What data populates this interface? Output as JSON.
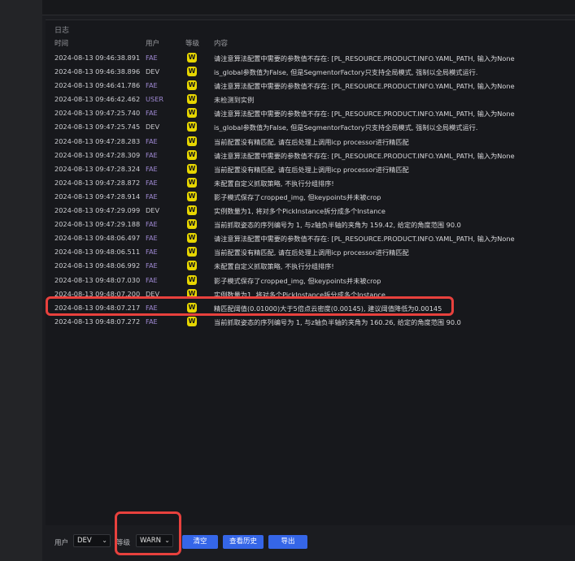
{
  "panel": {
    "title": "日志"
  },
  "columns": {
    "time": "时间",
    "user": "用户",
    "level": "等级",
    "message": "内容"
  },
  "rows": [
    {
      "time": "2024-08-13 09:46:38.891",
      "user": "FAE",
      "level": "W",
      "message": "请注意算法配置中需要的参数值不存在: [PL_RESOURCE.PRODUCT.INFO.YAML_PATH, 输入为None"
    },
    {
      "time": "2024-08-13 09:46:38.896",
      "user": "DEV",
      "level": "W",
      "message": "is_global参数值为False, 但是SegmentorFactory只支持全局模式, 强制以全局模式运行."
    },
    {
      "time": "2024-08-13 09:46:41.786",
      "user": "FAE",
      "level": "W",
      "message": "请注意算法配置中需要的参数值不存在: [PL_RESOURCE.PRODUCT.INFO.YAML_PATH, 输入为None"
    },
    {
      "time": "2024-08-13 09:46:42.462",
      "user": "USER",
      "level": "W",
      "message": "未检测到实例"
    },
    {
      "time": "2024-08-13 09:47:25.740",
      "user": "FAE",
      "level": "W",
      "message": "请注意算法配置中需要的参数值不存在: [PL_RESOURCE.PRODUCT.INFO.YAML_PATH, 输入为None"
    },
    {
      "time": "2024-08-13 09:47:25.745",
      "user": "DEV",
      "level": "W",
      "message": "is_global参数值为False, 但是SegmentorFactory只支持全局模式, 强制以全局模式运行."
    },
    {
      "time": "2024-08-13 09:47:28.283",
      "user": "FAE",
      "level": "W",
      "message": "当前配置没有精匹配, 请在后处理上调用icp processor进行精匹配"
    },
    {
      "time": "2024-08-13 09:47:28.309",
      "user": "FAE",
      "level": "W",
      "message": "请注意算法配置中需要的参数值不存在: [PL_RESOURCE.PRODUCT.INFO.YAML_PATH, 输入为None"
    },
    {
      "time": "2024-08-13 09:47:28.324",
      "user": "FAE",
      "level": "W",
      "message": "当前配置没有精匹配, 请在后处理上调用icp processor进行精匹配"
    },
    {
      "time": "2024-08-13 09:47:28.872",
      "user": "FAE",
      "level": "W",
      "message": "未配置自定义抓取策略, 不执行分组排序!"
    },
    {
      "time": "2024-08-13 09:47:28.914",
      "user": "FAE",
      "level": "W",
      "message": "影子模式保存了cropped_img, 但keypoints并未被crop"
    },
    {
      "time": "2024-08-13 09:47:29.099",
      "user": "DEV",
      "level": "W",
      "message": "实例数量为1, 将对多个PickInstance拆分成多个Instance"
    },
    {
      "time": "2024-08-13 09:47:29.188",
      "user": "FAE",
      "level": "W",
      "message": "当前抓取姿态的序列编号为 1, 与z轴负半轴的夹角为 159.42, 给定的角度范围 90.0"
    },
    {
      "time": "2024-08-13 09:48:06.497",
      "user": "FAE",
      "level": "W",
      "message": "请注意算法配置中需要的参数值不存在: [PL_RESOURCE.PRODUCT.INFO.YAML_PATH, 输入为None"
    },
    {
      "time": "2024-08-13 09:48:06.511",
      "user": "FAE",
      "level": "W",
      "message": "当前配置没有精匹配, 请在后处理上调用icp processor进行精匹配"
    },
    {
      "time": "2024-08-13 09:48:06.992",
      "user": "FAE",
      "level": "W",
      "message": "未配置自定义抓取策略, 不执行分组排序!"
    },
    {
      "time": "2024-08-13 09:48:07.030",
      "user": "FAE",
      "level": "W",
      "message": "影子模式保存了cropped_img, 但keypoints并未被crop"
    },
    {
      "time": "2024-08-13 09:48:07.200",
      "user": "DEV",
      "level": "W",
      "message": "实例数量为1, 将对多个PickInstance拆分成多个Instance"
    },
    {
      "time": "2024-08-13 09:48:07.217",
      "user": "FAE",
      "level": "W",
      "message": "精匹配阈值(0.01000)大于5倍点云密度(0.00145), 建议阈值降低为0.00145"
    },
    {
      "time": "2024-08-13 09:48:07.272",
      "user": "FAE",
      "level": "W",
      "message": "当前抓取姿态的序列编号为 1, 与z轴负半轴的夹角为 160.26, 给定的角度范围 90.0"
    }
  ],
  "footer": {
    "user_label": "用户",
    "user_value": "DEV",
    "level_label": "等级",
    "level_value": "WARN",
    "clear_label": "清空",
    "history_label": "查看历史",
    "export_label": "导出"
  },
  "colors": {
    "accent": "#3566e8",
    "warn_badge": "#e7d600",
    "highlight": "#e8413d"
  }
}
